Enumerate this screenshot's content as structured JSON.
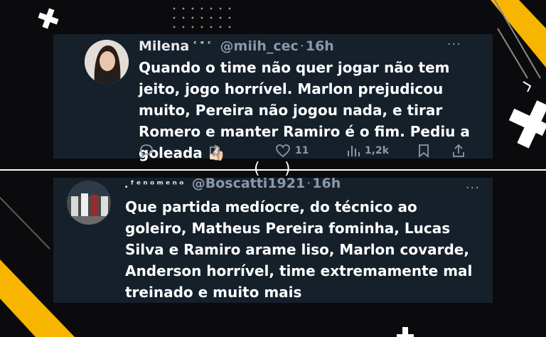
{
  "background": {
    "base": "#0b0b0d",
    "accent_yellow": "#f7b500",
    "accent_white": "#ffffff"
  },
  "divider": {
    "left": "(",
    "right": ")"
  },
  "tweets": [
    {
      "name": "Milena",
      "name_suffix": "ᶜᵉᶜ",
      "handle": "@miih_cec",
      "separator": "·",
      "time": "16h",
      "more": "···",
      "text": "Quando o time não quer jogar não tem jeito, jogo horrível. Marlon prejudicou muito, Pereira não jogou nada, e tirar Romero e manter Ramiro é o fim. Pediu a goleada 👍🏻",
      "actions": {
        "likes": "11",
        "views": "1,2k"
      },
      "icons": [
        "reply-icon",
        "retweet-icon",
        "like-icon",
        "views-icon",
        "bookmark-icon",
        "share-icon"
      ]
    },
    {
      "name": ".ᶠᵉⁿᵒᵐᵉⁿᵒ",
      "handle": "@Boscatti1921",
      "separator": "·",
      "time": "16h",
      "more": "···",
      "text": "Que partida medíocre, do técnico ao goleiro, Matheus Pereira fominha, Lucas Silva e Ramiro arame liso, Marlon covarde, Anderson horrível, time extremamente mal treinado e muito mais"
    }
  ]
}
